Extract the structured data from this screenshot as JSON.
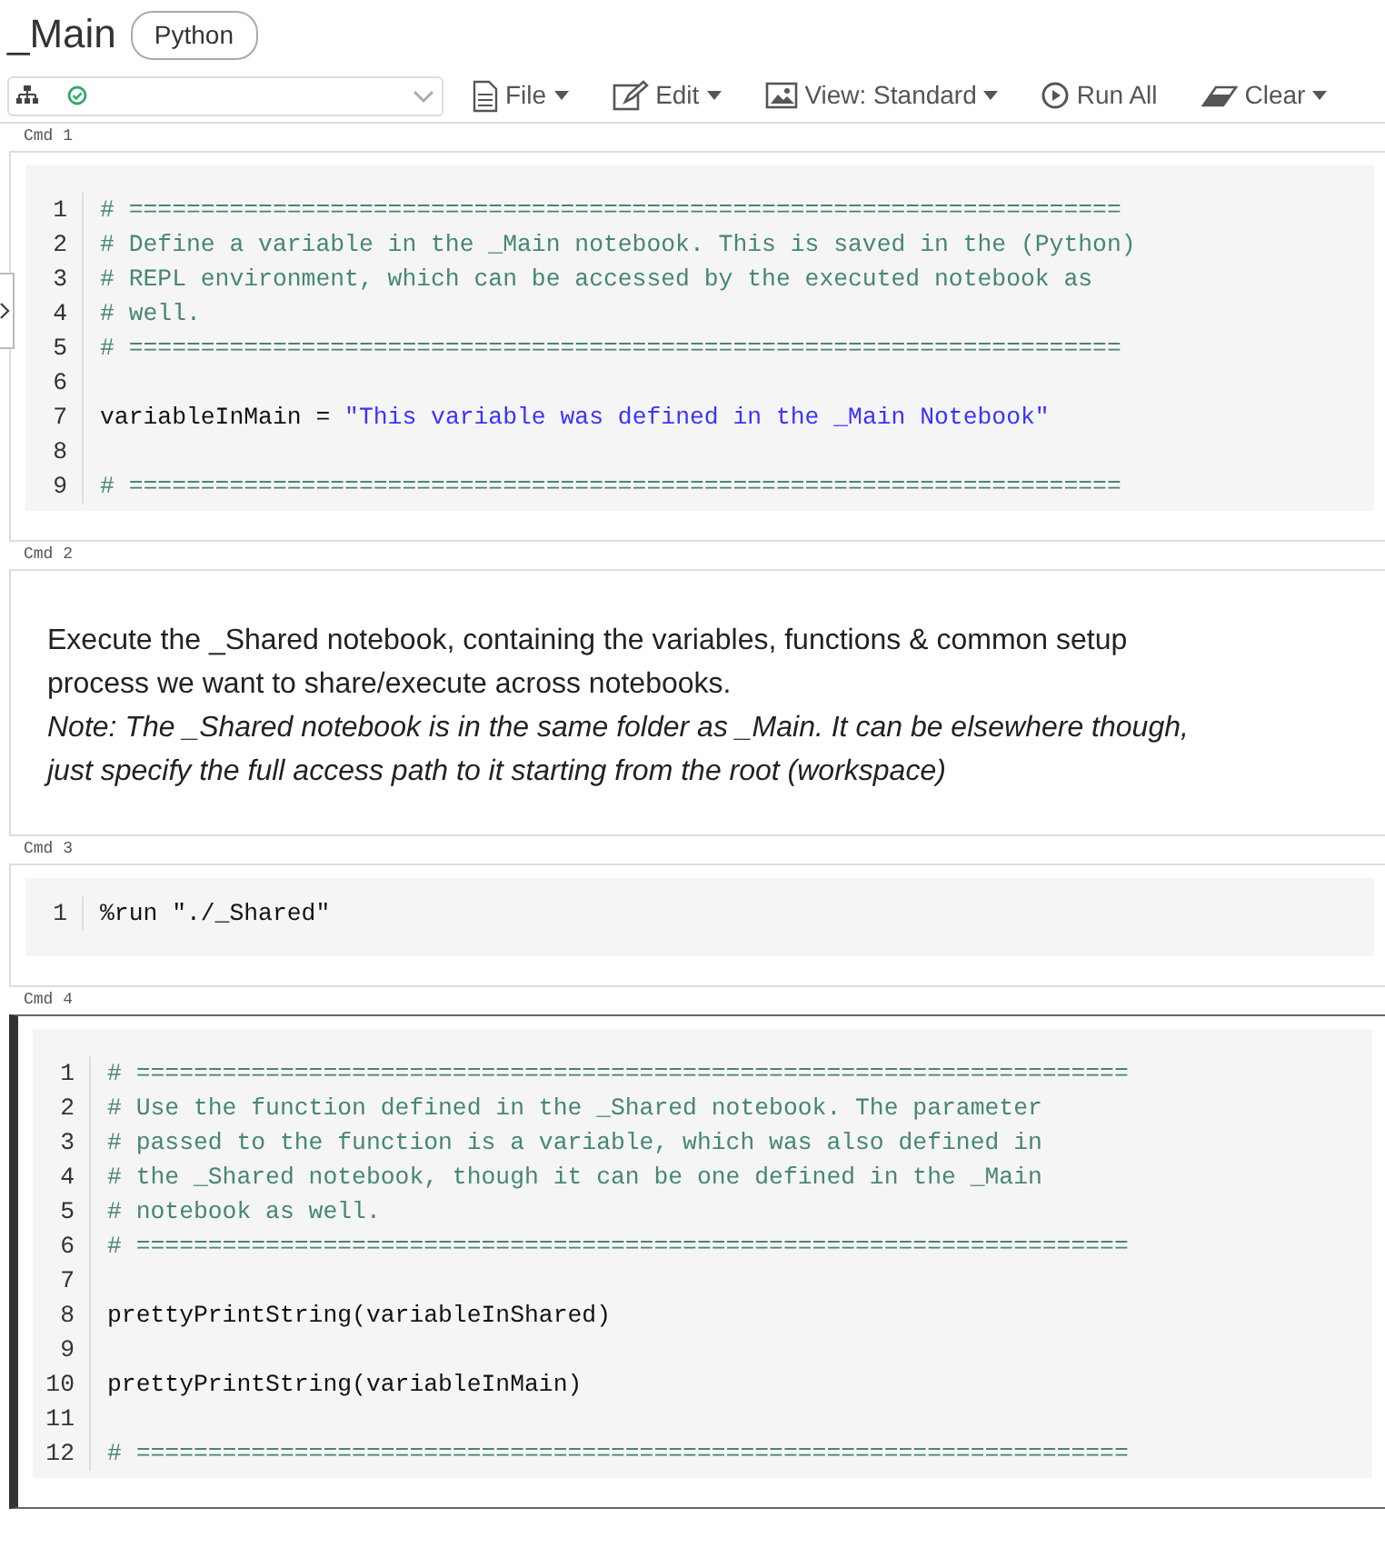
{
  "notebook": {
    "title": "_Main",
    "language": "Python"
  },
  "toolbar": {
    "menus": [
      {
        "label": "File",
        "has_caret": true
      },
      {
        "label": "Edit",
        "has_caret": true
      },
      {
        "label": "View: Standard",
        "has_caret": true
      },
      {
        "label": "Run All",
        "has_caret": false
      },
      {
        "label": "Clear",
        "has_caret": true
      }
    ]
  },
  "cells": [
    {
      "label": "Cmd 1",
      "kind": "code",
      "selected": false,
      "lines": [
        {
          "no": "1",
          "segments": [
            {
              "kind": "comment",
              "text": "# ====================================================================="
            }
          ]
        },
        {
          "no": "2",
          "segments": [
            {
              "kind": "comment",
              "text": "# Define a variable in the _Main notebook. This is saved in the (Python)"
            }
          ]
        },
        {
          "no": "3",
          "segments": [
            {
              "kind": "comment",
              "text": "# REPL environment, which can be accessed by the executed notebook as"
            }
          ]
        },
        {
          "no": "4",
          "segments": [
            {
              "kind": "comment",
              "text": "# well."
            }
          ]
        },
        {
          "no": "5",
          "segments": [
            {
              "kind": "comment",
              "text": "# ====================================================================="
            }
          ]
        },
        {
          "no": "6"
        },
        {
          "no": "7",
          "segments": [
            {
              "kind": "plain",
              "text": "variableInMain = "
            },
            {
              "kind": "string",
              "text": "\"This variable was defined in the _Main Notebook\""
            }
          ]
        },
        {
          "no": "8"
        },
        {
          "no": "9",
          "segments": [
            {
              "kind": "comment",
              "text": "# ====================================================================="
            }
          ]
        }
      ]
    },
    {
      "label": "Cmd 2",
      "kind": "markdown",
      "selected": false,
      "paragraphs": [
        {
          "italic": false,
          "text": "Execute the _Shared notebook, containing the variables, functions & common setup process we want to share/execute across notebooks."
        },
        {
          "italic": true,
          "text": "Note: The _Shared notebook is in the same folder as _Main. It can be elsewhere though, just specify the full access path to it starting from the root (workspace)"
        }
      ]
    },
    {
      "label": "Cmd 3",
      "kind": "code",
      "selected": false,
      "lines": [
        {
          "no": "1",
          "segments": [
            {
              "kind": "plain",
              "text": "%run \"./_Shared\""
            }
          ]
        }
      ]
    },
    {
      "label": "Cmd 4",
      "kind": "code",
      "selected": true,
      "lines": [
        {
          "no": "1",
          "segments": [
            {
              "kind": "comment",
              "text": "# ====================================================================="
            }
          ]
        },
        {
          "no": "2",
          "segments": [
            {
              "kind": "comment",
              "text": "# Use the function defined in the _Shared notebook. The parameter"
            }
          ]
        },
        {
          "no": "3",
          "segments": [
            {
              "kind": "comment",
              "text": "# passed to the function is a variable, which was also defined in"
            }
          ]
        },
        {
          "no": "4",
          "segments": [
            {
              "kind": "comment",
              "text": "# the _Shared notebook, though it can be one defined in the _Main"
            }
          ]
        },
        {
          "no": "5",
          "segments": [
            {
              "kind": "comment",
              "text": "# notebook as well."
            }
          ]
        },
        {
          "no": "6",
          "segments": [
            {
              "kind": "comment",
              "text": "# ====================================================================="
            }
          ]
        },
        {
          "no": "7"
        },
        {
          "no": "8",
          "segments": [
            {
              "kind": "plain",
              "text": "prettyPrintString(variableInShared)"
            }
          ]
        },
        {
          "no": "9"
        },
        {
          "no": "10",
          "segments": [
            {
              "kind": "plain",
              "text": "prettyPrintString(variableInMain)"
            }
          ]
        },
        {
          "no": "11"
        },
        {
          "no": "12",
          "segments": [
            {
              "kind": "comment",
              "text": "# ====================================================================="
            }
          ]
        }
      ]
    }
  ]
}
